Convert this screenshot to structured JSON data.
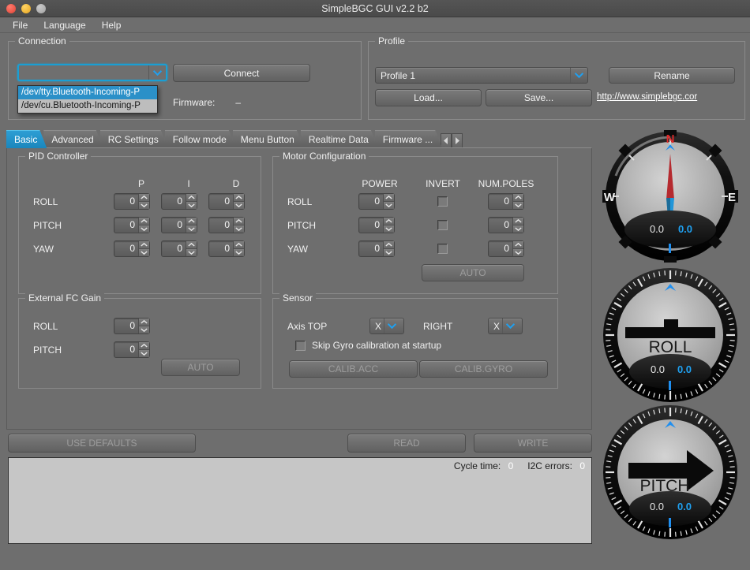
{
  "window": {
    "title": "SimpleBGC GUI v2.2 b2",
    "traffic_lights": [
      "close-red",
      "minimize-yellow",
      "zoom-gray"
    ]
  },
  "menubar": {
    "items": [
      "File",
      "Language",
      "Help"
    ]
  },
  "connection": {
    "legend": "Connection",
    "port_value": "",
    "port_options": [
      "/dev/tty.Bluetooth-Incoming-P",
      "/dev/cu.Bluetooth-Incoming-P"
    ],
    "selected_index": 0,
    "connect_label": "Connect",
    "firmware_label": "Firmware:",
    "firmware_value": "–"
  },
  "profile": {
    "legend": "Profile",
    "selected": "Profile 1",
    "rename_label": "Rename",
    "load_label": "Load...",
    "save_label": "Save...",
    "site_url": "http://www.simplebgc.cor"
  },
  "tabs": {
    "items": [
      {
        "label": "Basic",
        "active": true
      },
      {
        "label": "Advanced",
        "active": false
      },
      {
        "label": "RC Settings",
        "active": false
      },
      {
        "label": "Follow mode",
        "active": false
      },
      {
        "label": "Menu Button",
        "active": false
      },
      {
        "label": "Realtime Data",
        "active": false
      },
      {
        "label": "Firmware ...",
        "active": false
      }
    ],
    "scroll_left": "◀",
    "scroll_right": "▶"
  },
  "pid": {
    "legend": "PID Controller",
    "columns": [
      "P",
      "I",
      "D"
    ],
    "rows": [
      {
        "axis": "ROLL",
        "values": [
          "0",
          "0",
          "0"
        ]
      },
      {
        "axis": "PITCH",
        "values": [
          "0",
          "0",
          "0"
        ]
      },
      {
        "axis": "YAW",
        "values": [
          "0",
          "0",
          "0"
        ]
      }
    ]
  },
  "motor": {
    "legend": "Motor Configuration",
    "columns": [
      "POWER",
      "INVERT",
      "NUM.POLES"
    ],
    "rows": [
      {
        "axis": "ROLL",
        "power": "0",
        "invert": false,
        "poles": "0"
      },
      {
        "axis": "PITCH",
        "power": "0",
        "invert": false,
        "poles": "0"
      },
      {
        "axis": "YAW",
        "power": "0",
        "invert": false,
        "poles": "0"
      }
    ],
    "auto_label": "AUTO"
  },
  "external_fc": {
    "legend": "External FC Gain",
    "rows": [
      {
        "axis": "ROLL",
        "value": "0"
      },
      {
        "axis": "PITCH",
        "value": "0"
      }
    ],
    "auto_label": "AUTO"
  },
  "sensor": {
    "legend": "Sensor",
    "axis_top_label": "Axis TOP",
    "axis_top_value": "X",
    "right_label": "RIGHT",
    "right_value": "X",
    "skip_gyro_label": "Skip Gyro calibration at startup",
    "skip_gyro_checked": false,
    "calib_acc_label": "CALIB.ACC",
    "calib_gyro_label": "CALIB.GYRO"
  },
  "actions": {
    "use_defaults_label": "USE DEFAULTS",
    "read_label": "READ",
    "write_label": "WRITE"
  },
  "log": {
    "cycle_time_label": "Cycle time:",
    "cycle_time_value": "0",
    "i2c_errors_label": "I2C errors:",
    "i2c_errors_value": "0",
    "text": ""
  },
  "gauges": [
    {
      "name": "compass",
      "kind": "compass",
      "cardinals": {
        "north": "N",
        "west": "W",
        "east": "E"
      },
      "value_white": "0.0",
      "value_blue": "0.0"
    },
    {
      "name": "roll",
      "kind": "roll",
      "title": "ROLL",
      "value_white": "0.0",
      "value_blue": "0.0"
    },
    {
      "name": "pitch",
      "kind": "pitch",
      "title": "PITCH",
      "value_white": "0.0",
      "value_blue": "0.0"
    }
  ],
  "colors": {
    "accent_blue": "#2b90c8",
    "window_bg": "#6e6e6e",
    "needle_red": "#b52a2f",
    "needle_blue": "#2196d9",
    "readout_blue": "#1fa0f0",
    "log_bg": "#c6c6c6"
  }
}
